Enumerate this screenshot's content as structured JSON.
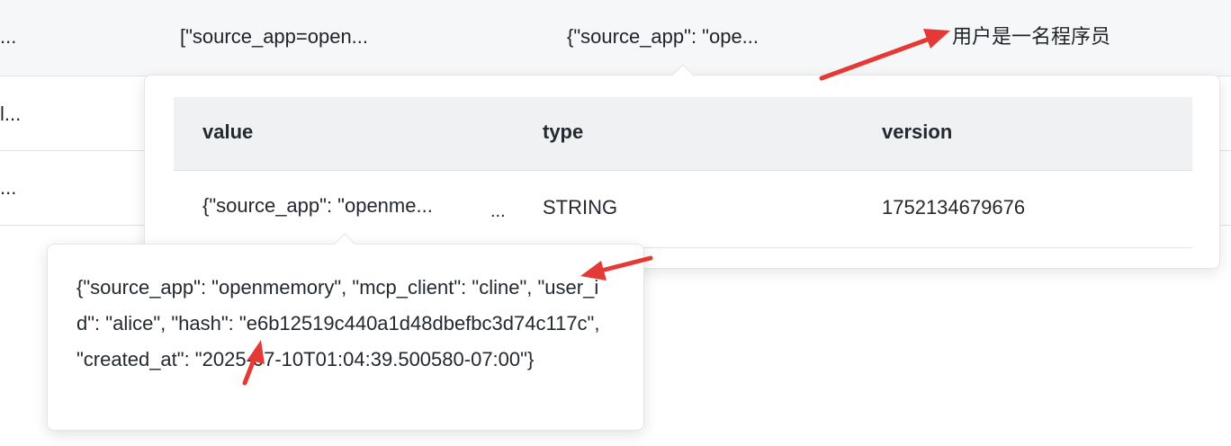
{
  "background_table": {
    "rows": [
      {
        "col1": "...",
        "col2": "[\"source_app=open...",
        "col3": "{\"source_app\": \"ope...",
        "col4": "用户是一名程序员"
      },
      {
        "col1": "l..."
      },
      {
        "col1": "..."
      }
    ]
  },
  "popover": {
    "columns": [
      "value",
      "type",
      "version"
    ],
    "row": {
      "value": "{\"source_app\": \"openme...",
      "more": "...",
      "type": "STRING",
      "version": "1752134679676"
    }
  },
  "tooltip": {
    "text": "{\"source_app\": \"openmemory\", \"mcp_client\": \"cline\", \"user_id\": \"alice\", \"hash\": \"e6b12519c440a1d48dbefbc3d74c117c\", \"created_at\": \"2025-07-10T01:04:39.500580-07:00\"}"
  },
  "colors": {
    "annotation_arrow": "#e53935",
    "header_bg": "#f0f1f3",
    "border": "#dfe2e6"
  },
  "icons": {
    "annotation": "arrow-icon"
  }
}
